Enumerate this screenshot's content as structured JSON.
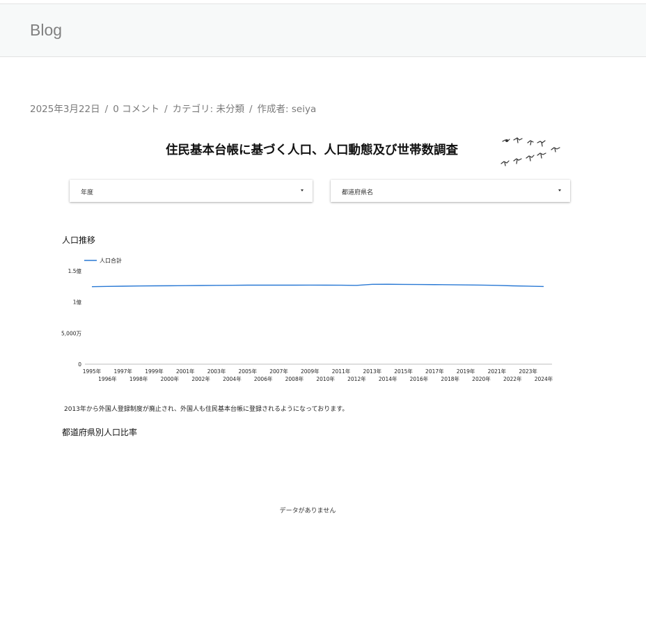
{
  "site": {
    "title": "Blog"
  },
  "post": {
    "date": "2025年3月22日",
    "comments": "0 コメント",
    "category": "カテゴリ: 未分類",
    "author": "作成者: seiya",
    "separator": "/"
  },
  "report": {
    "title": "住民基本台帳に基づく人口、人口動態及び世帯数調査",
    "filters": [
      {
        "label": "年度"
      },
      {
        "label": "都道府県名"
      }
    ]
  },
  "sections": {
    "population_trend": "人口推移",
    "prefecture_ratio": "都道府県別人口比率"
  },
  "chart_data": {
    "type": "line",
    "title": "人口推移",
    "x": [
      "1995年",
      "1996年",
      "1997年",
      "1998年",
      "1999年",
      "2000年",
      "2001年",
      "2002年",
      "2003年",
      "2004年",
      "2005年",
      "2006年",
      "2007年",
      "2008年",
      "2009年",
      "2010年",
      "2011年",
      "2012年",
      "2013年",
      "2014年",
      "2015年",
      "2016年",
      "2017年",
      "2018年",
      "2019年",
      "2020年",
      "2021年",
      "2022年",
      "2023年",
      "2024年"
    ],
    "series": [
      {
        "name": "人口合計",
        "color": "#2878d4",
        "values": [
          124655000,
          124994000,
          125371000,
          125707000,
          125934000,
          126071000,
          126285000,
          126479000,
          126689000,
          126869000,
          127059000,
          127055000,
          127053000,
          127067000,
          127077000,
          127058000,
          126924000,
          126659000,
          128374000,
          128438000,
          128226000,
          128066000,
          127907000,
          127707000,
          127444000,
          127138000,
          126655000,
          125928000,
          125416000,
          124885000
        ]
      }
    ],
    "y_ticks": [
      {
        "value": 0,
        "label": "0"
      },
      {
        "value": 50000000,
        "label": "5,000万"
      },
      {
        "value": 100000000,
        "label": "1億"
      },
      {
        "value": 150000000,
        "label": "1.5億"
      }
    ],
    "ylim": [
      0,
      150000000
    ],
    "grid": false,
    "legend": "top-left"
  },
  "note": "2013年から外国人登録制度が廃止され、外国人も住民基本台帳に登録されるようになっております。",
  "pie": {
    "empty_message": "データがありません"
  },
  "colors": {
    "accent": "#2878d4",
    "header_bg": "#f7f9f9"
  }
}
